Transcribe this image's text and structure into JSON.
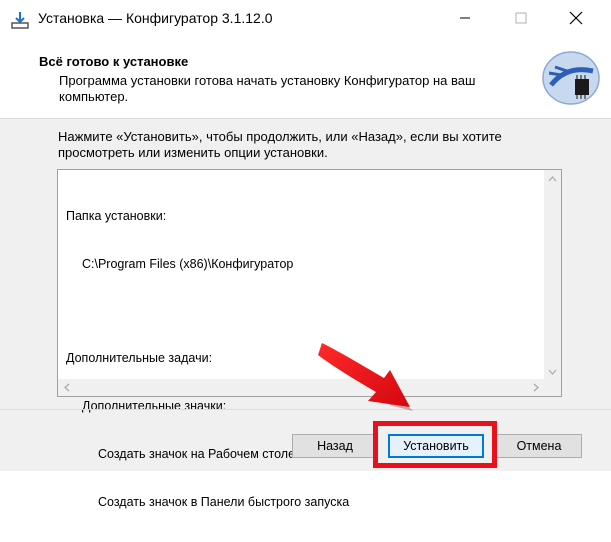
{
  "window": {
    "title": "Установка — Конфигуратор 3.1.12.0"
  },
  "header": {
    "title": "Всё готово к установке",
    "subtitle": "Программа установки готова начать установку Конфигуратор на ваш компьютер."
  },
  "main": {
    "instruction": "Нажмите «Установить», чтобы продолжить, или «Назад», если вы хотите просмотреть или изменить опции установки.",
    "memo": {
      "folder_label": "Папка установки:",
      "folder_path": "C:\\Program Files (x86)\\Конфигуратор",
      "tasks_label": "Дополнительные задачи:",
      "icons_label": "Дополнительные значки:",
      "task_desktop": "Создать значок на Рабочем столе",
      "task_quicklaunch": "Создать значок в Панели быстрого запуска"
    }
  },
  "buttons": {
    "back": "Назад",
    "install": "Установить",
    "cancel": "Отмена"
  },
  "icons": {
    "app": "installer-download-icon",
    "logo": "setup-wizard-logo-icon",
    "minimize": "minimize-icon",
    "maximize": "maximize-icon",
    "close": "close-icon"
  },
  "annotation": {
    "highlight_color": "#e8101a"
  }
}
